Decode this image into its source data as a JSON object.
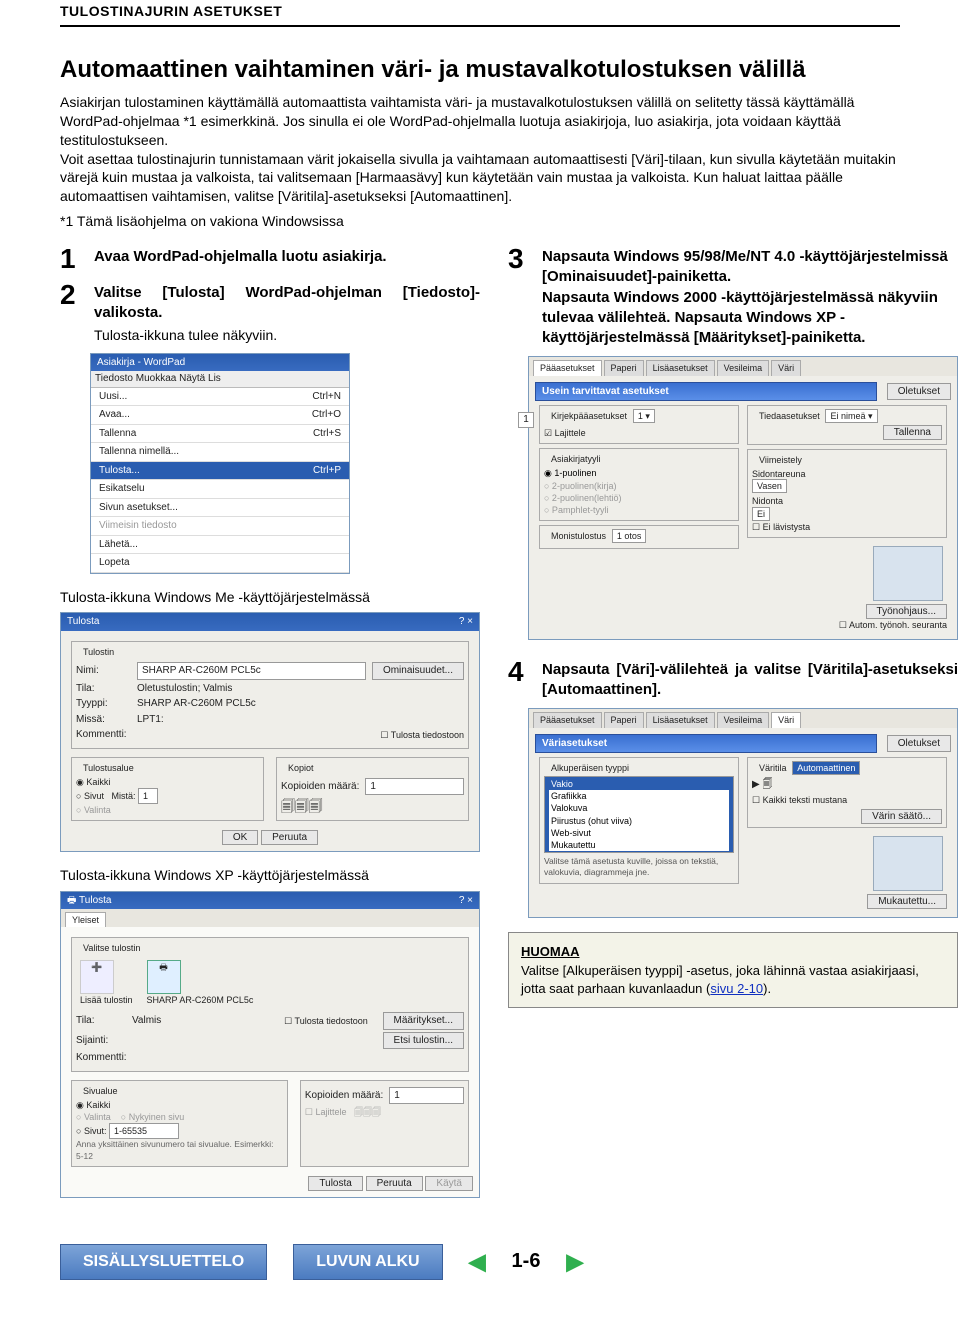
{
  "header": {
    "section": "TULOSTINAJURIN ASETUKSET"
  },
  "title": "Automaattinen vaihtaminen väri- ja mustavalkotulostuksen välillä",
  "intro": "Asiakirjan tulostaminen käyttämällä automaattista vaihtamista väri- ja mustavalkotulostuksen välillä on selitetty tässä käyttämällä WordPad-ohjelmaa *1 esimerkkinä. Jos sinulla ei ole WordPad-ohjelmalla luotuja asiakirjoja, luo asiakirja, jota voidaan käyttää testitulostukseen.\nVoit asettaa tulostinajurin tunnistamaan värit jokaisella sivulla ja vaihtamaan automaattisesti [Väri]-tilaan, kun sivulla käytetään muitakin värejä kuin mustaa ja valkoista, tai valitsemaan [Harmaasävy] kun käytetään vain mustaa ja valkoista. Kun haluat laittaa päälle automaattisen vaihtamisen, valitse [Väritila]-asetukseksi [Automaattinen].",
  "footnote": "*1   Tämä lisäohjelma on vakiona Windowsissa",
  "steps": {
    "s1": "Avaa WordPad-ohjelmalla luotu asiakirja.",
    "s2a": "Valitse [Tulosta] WordPad-ohjelman [Tiedosto]-valikosta.",
    "s2b": "Tulosta-ikkuna tulee näkyviin.",
    "cap_me": "Tulosta-ikkuna Windows Me -käyttöjärjestelmässä",
    "cap_xp": "Tulosta-ikkuna Windows XP -käyttöjärjestelmässä",
    "s3": "Napsauta Windows 95/98/Me/NT 4.0 -käyttöjärjestelmissä [Ominaisuudet]-painiketta.\nNapsauta Windows 2000 -käyttöjärjestelmässä näkyviin tulevaa välilehteä. Napsauta Windows XP -käyttöjärjestelmässä [Määritykset]-painiketta.",
    "s4": "Napsauta [Väri]-välilehteä ja valitse [Väritila]-asetukseksi [Automaattinen]."
  },
  "menu": {
    "titlebar": "Asiakirja - WordPad",
    "menubar": "Tiedosto  Muokkaa  Näytä  Lis",
    "items": [
      {
        "label": "Uusi...",
        "accel": "Ctrl+N"
      },
      {
        "label": "Avaa...",
        "accel": "Ctrl+O"
      },
      {
        "label": "Tallenna",
        "accel": "Ctrl+S"
      },
      {
        "label": "Tallenna nimellä...",
        "accel": ""
      },
      {
        "label": "Tulosta...",
        "accel": "Ctrl+P",
        "selected": true
      },
      {
        "label": "Esikatselu",
        "accel": ""
      },
      {
        "label": "Sivun asetukset...",
        "accel": ""
      },
      {
        "label": "Viimeisin tiedosto",
        "accel": "",
        "disabled": true
      },
      {
        "label": "Lähetä...",
        "accel": ""
      },
      {
        "label": "Lopeta",
        "accel": ""
      }
    ]
  },
  "meprint": {
    "title": "Tulosta",
    "fields": {
      "nimi_lbl": "Nimi:",
      "nimi_val": "SHARP AR-C260M PCL5c",
      "ominaisuudet": "Ominaisuudet...",
      "tila_lbl": "Tila:",
      "tila_val": "Oletustulostin; Valmis",
      "tyyppi_lbl": "Tyyppi:",
      "tyyppi_val": "SHARP AR-C260M PCL5c",
      "missa_lbl": "Missä:",
      "missa_val": "LPT1:",
      "komm_lbl": "Kommentti:",
      "file_cb": "Tulosta tiedostoon"
    },
    "alue": {
      "grp": "Tulostusalue",
      "kaikki": "Kaikki",
      "sivut": "Sivut",
      "mista": "Mistä:",
      "val1": "1",
      "valinta": "Valinta"
    },
    "kopiot": {
      "grp": "Kopiot",
      "lbl": "Kopioiden määrä:",
      "val": "1"
    },
    "ok": "OK",
    "cancel": "Peruuta"
  },
  "xpprint": {
    "title": "Tulosta",
    "tab": "Yleiset",
    "chooser": "Valitse tulostin",
    "add": "Lisää tulostin",
    "printer": "SHARP AR-C260M PCL5c",
    "tila_lbl": "Tila:",
    "tila_val": "Valmis",
    "sijainti_lbl": "Sijainti:",
    "komm_lbl": "Kommentti:",
    "file_cb": "Tulosta tiedostoon",
    "maar": "Määritykset...",
    "etsi": "Etsi tulostin...",
    "alue": {
      "grp": "Sivualue",
      "kaikki": "Kaikki",
      "valinta": "Valinta",
      "nykyinen": "Nykyinen sivu",
      "sivut": "Sivut:",
      "val": "1-65535",
      "hint": "Anna yksittäinen sivunumero tai sivualue. Esimerkki: 5-12"
    },
    "kopiot_lbl": "Kopioiden määrä:",
    "kopiot_val": "1",
    "lajittele": "Lajittele",
    "tulosta": "Tulosta",
    "peruuta": "Peruuta",
    "kayra": "Käytä"
  },
  "props1": {
    "tabs": [
      "Pääasetukset",
      "Paperi",
      "Lisäasetukset",
      "Vesileima",
      "Väri"
    ],
    "active": 0,
    "bluebar": "Usein tarvittavat asetukset",
    "defaults": "Oletukset",
    "g1": "Kirjekpääasetukset",
    "g1opt": "Tiedaasetukset",
    "lajittele": "Lajittele",
    "asia": "Asiakirjatyyli",
    "radios": [
      "1-puolinen",
      "2-puolinen(kirja)",
      "2-puolinen(lehtiö)",
      "Pamphlet-tyyli"
    ],
    "viim": "Viimeistely",
    "sidonta": "Sidontareuna",
    "vasen": "Vasen",
    "nidonta": "Nidonta",
    "ei": "Ei",
    "rei": "Ei lävistysta",
    "mono": "Monistulostus",
    "mono_val": "1 otos",
    "tyo": "Työnohjaus...",
    "autom": "Autom. työnoh. seuranta"
  },
  "props2": {
    "tabs": [
      "Pääasetukset",
      "Paperi",
      "Lisäasetukset",
      "Vesileima",
      "Väri"
    ],
    "active": 4,
    "bluebar": "Väriasetukset",
    "defaults": "Oletukset",
    "g1": "Alkuperäisen tyyppi",
    "types": [
      "Vakio",
      "Grafiikka",
      "Valokuva",
      "Piirustus (ohut viiva)",
      "Web-sivut",
      "Mukautettu"
    ],
    "hint": "Valitse tämä asetusta kuville, joissa on tekstiä, valokuvia, diagrammeja jne.",
    "varitila": "Väritila",
    "varitila_val": "Automaattinen",
    "kaikki_cb": "Kaikki teksti mustana",
    "varin": "Värin säätö...",
    "mukauttu": "Mukautettu..."
  },
  "note": {
    "title": "HUOMAA",
    "body_a": "Valitse [Alkuperäisen tyyppi] -asetus, joka lähinnä vastaa asiakirjaasi, jotta saat parhaan kuvanlaadun (",
    "link": "sivu 2-10",
    "body_b": ")."
  },
  "nav": {
    "toc": "SISÄLLYSLUETTELO",
    "chap": "LUVUN ALKU",
    "page": "1-6"
  }
}
